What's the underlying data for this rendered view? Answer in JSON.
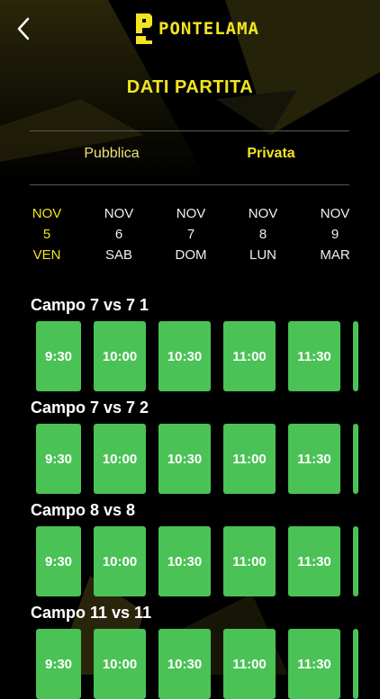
{
  "header": {
    "logo_text": "PONTELAMA",
    "title": "DATI PARTITA"
  },
  "tabs": [
    {
      "label": "Pubblica",
      "selected": false
    },
    {
      "label": "Privata",
      "selected": true
    }
  ],
  "dates": [
    {
      "month": "NOV",
      "day": "5",
      "weekday": "VEN",
      "selected": true
    },
    {
      "month": "NOV",
      "day": "6",
      "weekday": "SAB",
      "selected": false
    },
    {
      "month": "NOV",
      "day": "7",
      "weekday": "DOM",
      "selected": false
    },
    {
      "month": "NOV",
      "day": "8",
      "weekday": "LUN",
      "selected": false
    },
    {
      "month": "NOV",
      "day": "9",
      "weekday": "MAR",
      "selected": false
    }
  ],
  "fields": [
    {
      "name": "Campo 7 vs 7 1",
      "slots": [
        "9:30",
        "10:00",
        "10:30",
        "11:00",
        "11:30"
      ]
    },
    {
      "name": "Campo 7 vs 7 2",
      "slots": [
        "9:30",
        "10:00",
        "10:30",
        "11:00",
        "11:30"
      ]
    },
    {
      "name": "Campo 8 vs 8",
      "slots": [
        "9:30",
        "10:00",
        "10:30",
        "11:00",
        "11:30"
      ]
    },
    {
      "name": "Campo 11 vs 11",
      "slots": [
        "9:30",
        "10:00",
        "10:30",
        "11:00",
        "11:30"
      ]
    }
  ],
  "colors": {
    "accent": "#f2e51f",
    "slot": "#4ac255",
    "background": "#000000"
  },
  "icons": {
    "back": "chevron-left-icon",
    "logo": "pontelama-logo-icon"
  }
}
